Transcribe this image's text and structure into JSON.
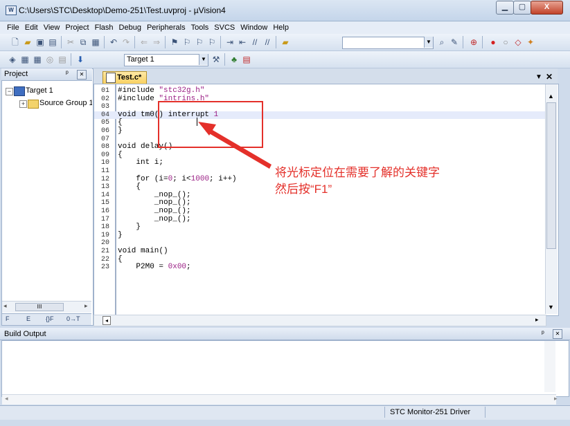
{
  "window": {
    "title": "C:\\Users\\STC\\Desktop\\Demo-251\\Test.uvproj - µVision4",
    "app_icon": "W",
    "minimize_glyph": "▁",
    "maximize_glyph": "▢",
    "close_glyph": "X"
  },
  "menu": [
    "File",
    "Edit",
    "View",
    "Project",
    "Flash",
    "Debug",
    "Peripherals",
    "Tools",
    "SVCS",
    "Window",
    "Help"
  ],
  "toolbar": {
    "target_select": "Target 1",
    "find_value": "",
    "dropdown_glyph": "▼"
  },
  "project_panel": {
    "title": "Project",
    "pin_glyph": "ᵖ",
    "close_glyph": "✕",
    "tree": {
      "target_toggle": "−",
      "target_label": "Target 1",
      "source_toggle": "+",
      "source_label": "Source Group 1"
    },
    "hscroll_left": "◂",
    "hscroll_thumb": "III",
    "hscroll_right": "▸",
    "tabs": [
      "F",
      "E",
      "{}F",
      "0→T"
    ]
  },
  "editor": {
    "tab_label": "Test.c*",
    "tab_menu_glyph": "▼",
    "tab_close_glyph": "✕",
    "scroll_up_glyph": "▲",
    "scroll_down_glyph": "▼",
    "hscroll_left_glyph": "◂",
    "hscroll_right_glyph": "▸",
    "lines": [
      {
        "n": "01",
        "text": "#include \"stc32g.h\""
      },
      {
        "n": "02",
        "text": "#include \"intrins.h\""
      },
      {
        "n": "03",
        "text": ""
      },
      {
        "n": "04",
        "text": "void tm0() interrupt 1"
      },
      {
        "n": "05",
        "text": "{"
      },
      {
        "n": "06",
        "text": "}"
      },
      {
        "n": "07",
        "text": ""
      },
      {
        "n": "08",
        "text": "void delay()"
      },
      {
        "n": "09",
        "text": "{"
      },
      {
        "n": "10",
        "text": "    int i;"
      },
      {
        "n": "11",
        "text": ""
      },
      {
        "n": "12",
        "text": "    for (i=0; i<1000; i++)"
      },
      {
        "n": "13",
        "text": "    {"
      },
      {
        "n": "14",
        "text": "        _nop_();"
      },
      {
        "n": "15",
        "text": "        _nop_();"
      },
      {
        "n": "16",
        "text": "        _nop_();"
      },
      {
        "n": "17",
        "text": "        _nop_();"
      },
      {
        "n": "18",
        "text": "    }"
      },
      {
        "n": "19",
        "text": "}"
      },
      {
        "n": "20",
        "text": ""
      },
      {
        "n": "21",
        "text": "void main()"
      },
      {
        "n": "22",
        "text": "{"
      },
      {
        "n": "23",
        "text": "    P2M0 = 0x00;"
      }
    ],
    "highlighted_line": "04"
  },
  "annotation": {
    "line1": "将光标定位在需要了解的关键字",
    "line2": "然后按“F1”",
    "color": "#e4302a"
  },
  "build_output": {
    "title": "Build Output",
    "pin_glyph": "ᵖ",
    "close_glyph": "✕",
    "hs_left": "◂",
    "hs_right": "▸",
    "content": ""
  },
  "statusbar": {
    "driver": "STC Monitor-251 Driver"
  }
}
